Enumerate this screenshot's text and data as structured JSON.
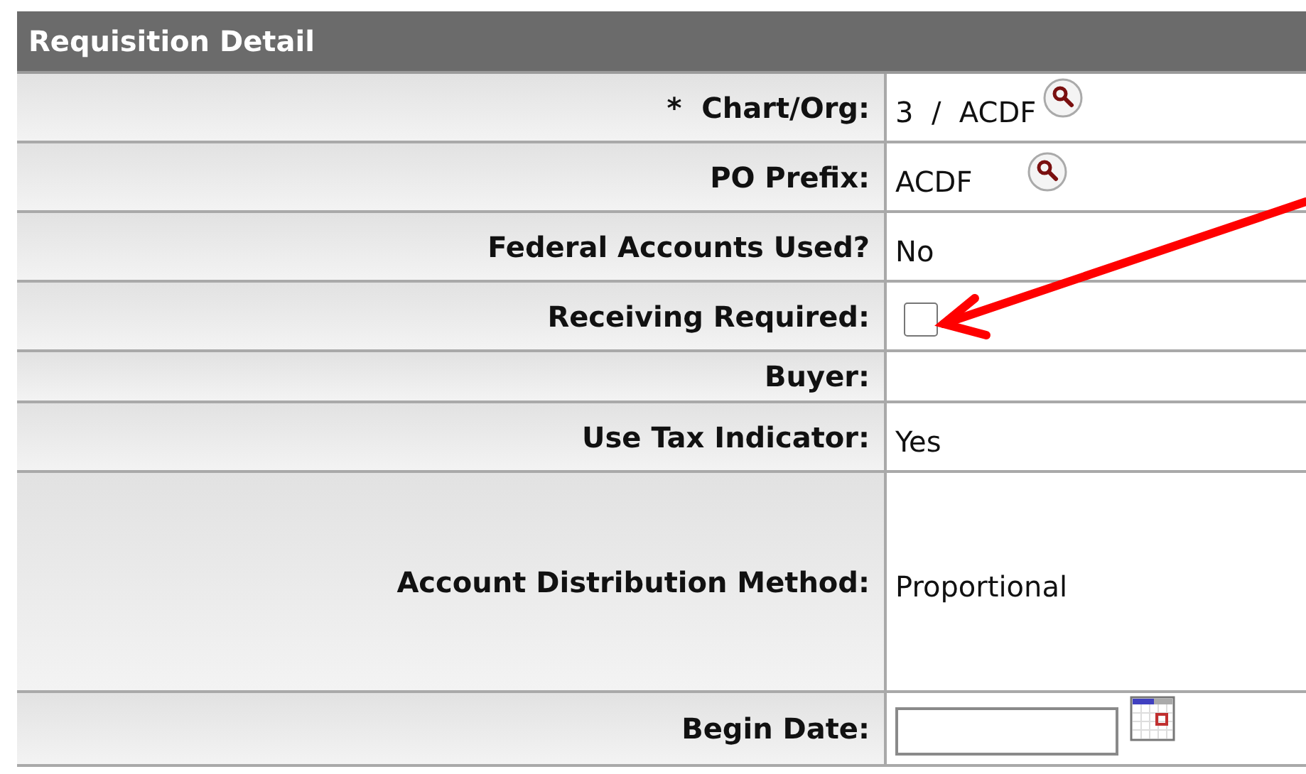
{
  "section": {
    "title": "Requisition Detail"
  },
  "rows": [
    {
      "kind": "lookup",
      "marker": "*",
      "label": "Chart/Org:",
      "value": "3  /  ACDF"
    },
    {
      "kind": "lookup",
      "label": "PO Prefix:",
      "value": "ACDF"
    },
    {
      "kind": "text",
      "label": "Federal Accounts Used?",
      "value": "No"
    },
    {
      "kind": "checkbox",
      "label": "Receiving Required:",
      "checked": false
    },
    {
      "kind": "text",
      "label": "Buyer:"
    },
    {
      "kind": "text",
      "label": "Use Tax Indicator:",
      "value": "Yes"
    },
    {
      "kind": "text",
      "tall": true,
      "label": "Account Distribution Method:",
      "value": "Proportional"
    },
    {
      "kind": "date",
      "label": "Begin Date:"
    }
  ]
}
